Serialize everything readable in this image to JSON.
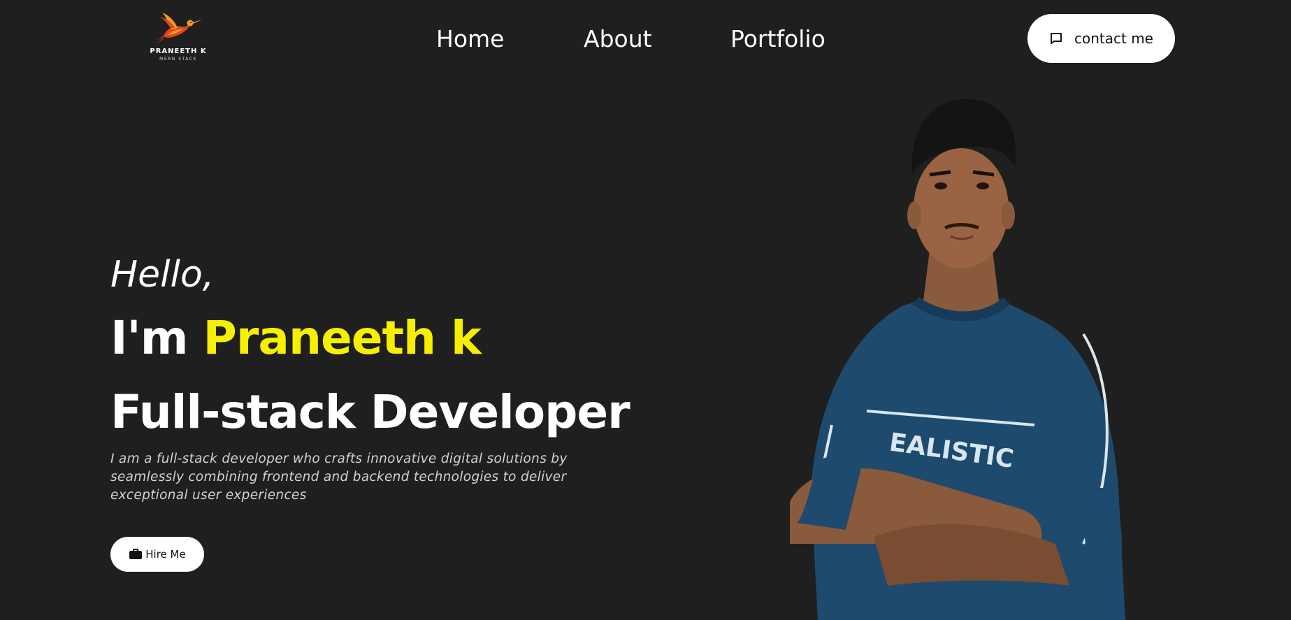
{
  "logo": {
    "name": "PRANEETH K",
    "subtitle": "MERN STACK",
    "icon": "hummingbird-icon",
    "colors": [
      "#e0461d",
      "#f29a22",
      "#7a2a2a"
    ]
  },
  "nav": {
    "items": [
      {
        "label": "Home"
      },
      {
        "label": "About"
      },
      {
        "label": "Portfolio"
      }
    ]
  },
  "contact_button": {
    "label": "contact me",
    "icon": "chat-icon"
  },
  "hero": {
    "greeting": "Hello,",
    "intro_prefix": "I'm ",
    "name": "Praneeth k",
    "role": "Full-stack Developer",
    "description": "I am a full-stack developer who crafts innovative digital solutions by seamlessly combining frontend and backend technologies to deliver exceptional user experiences",
    "hire_button": {
      "label": "Hire Me",
      "icon": "briefcase-icon"
    }
  },
  "colors": {
    "background": "#1f1f1f",
    "accent": "#f6f000",
    "text": "#ffffff",
    "button_bg": "#ffffff",
    "shirt": "#1e4a6e"
  }
}
